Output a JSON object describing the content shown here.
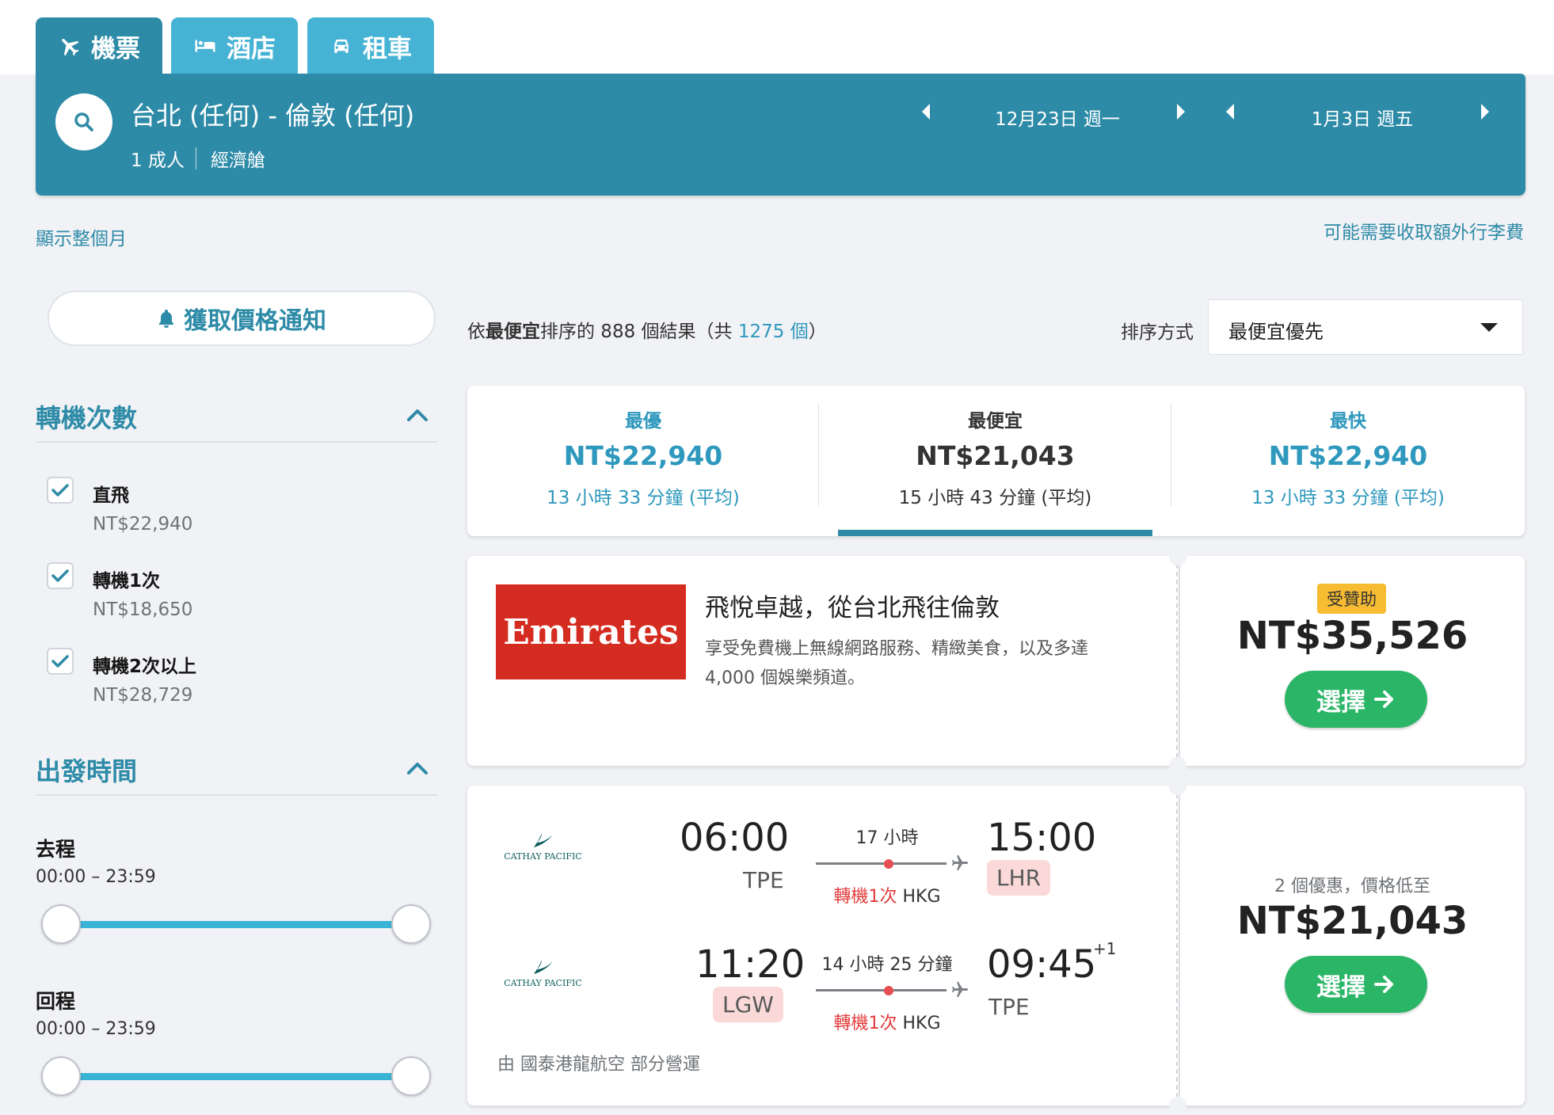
{
  "tabs": [
    {
      "label": "機票",
      "icon": "plane-icon"
    },
    {
      "label": "酒店",
      "icon": "bed-icon"
    },
    {
      "label": "租車",
      "icon": "car-icon"
    }
  ],
  "search": {
    "route": "台北 (任何) - 倫敦 (任何)",
    "passengers": "1 成人",
    "cabin": "經濟艙",
    "depart_date": "12月23日 週一",
    "return_date": "1月3日 週五"
  },
  "links": {
    "show_month": "顯示整個月",
    "baggage_fee": "可能需要收取額外行李費"
  },
  "notify_label": "獲取價格通知",
  "results": {
    "prefix": "依",
    "sort_word": "最便宜",
    "middle": "排序的 888 個結果（共 ",
    "total": "1275 個",
    "suffix": "）"
  },
  "sort": {
    "label": "排序方式",
    "selected": "最便宜優先"
  },
  "filters": {
    "stops_title": "轉機次數",
    "stops": [
      {
        "label": "直飛",
        "price": "NT$22,940",
        "checked": true
      },
      {
        "label": "轉機1次",
        "price": "NT$18,650",
        "checked": true
      },
      {
        "label": "轉機2次以上",
        "price": "NT$28,729",
        "checked": true
      }
    ],
    "departure_title": "出發時間",
    "outbound_label": "去程",
    "outbound_range": "00:00 – 23:59",
    "return_label": "回程",
    "return_range": "00:00 – 23:59"
  },
  "summary": [
    {
      "label": "最優",
      "price": "NT$22,940",
      "duration": "13 小時 33 分鐘 (平均)"
    },
    {
      "label": "最便宜",
      "price": "NT$21,043",
      "duration": "15 小時 43 分鐘 (平均)"
    },
    {
      "label": "最快",
      "price": "NT$22,940",
      "duration": "13 小時 33 分鐘 (平均)"
    }
  ],
  "ad": {
    "logo_text": "Emirates",
    "title": "飛悅卓越，從台北飛往倫敦",
    "desc_line1": "享受免費機上無線網路服務、精緻美食，以及多達",
    "desc_line2": "4,000 個娛樂頻道。",
    "badge": "受贊助",
    "price": "NT$35,526",
    "select": "選擇"
  },
  "flight": {
    "airline_logo_text": "CATHAY PACIFIC",
    "outbound": {
      "depart_time": "06:00",
      "depart_code": "TPE",
      "duration": "17 小時",
      "stops": "轉機1次",
      "via": "HKG",
      "arrive_time": "15:00",
      "arrive_code": "LHR"
    },
    "inbound": {
      "depart_time": "11:20",
      "depart_code": "LGW",
      "duration": "14 小時 25 分鐘",
      "stops": "轉機1次",
      "via": "HKG",
      "arrive_time": "09:45",
      "day_offset": "+1",
      "arrive_code": "TPE"
    },
    "operated_by": "由 國泰港龍航空 部分營運",
    "deals": "2 個優惠，價格低至",
    "price": "NT$21,043",
    "select": "選擇"
  },
  "colors": {
    "primary": "#2e8ba7",
    "tab_inactive": "#47b3d4",
    "select_green": "#2bb567",
    "emirates_red": "#d52c21"
  }
}
